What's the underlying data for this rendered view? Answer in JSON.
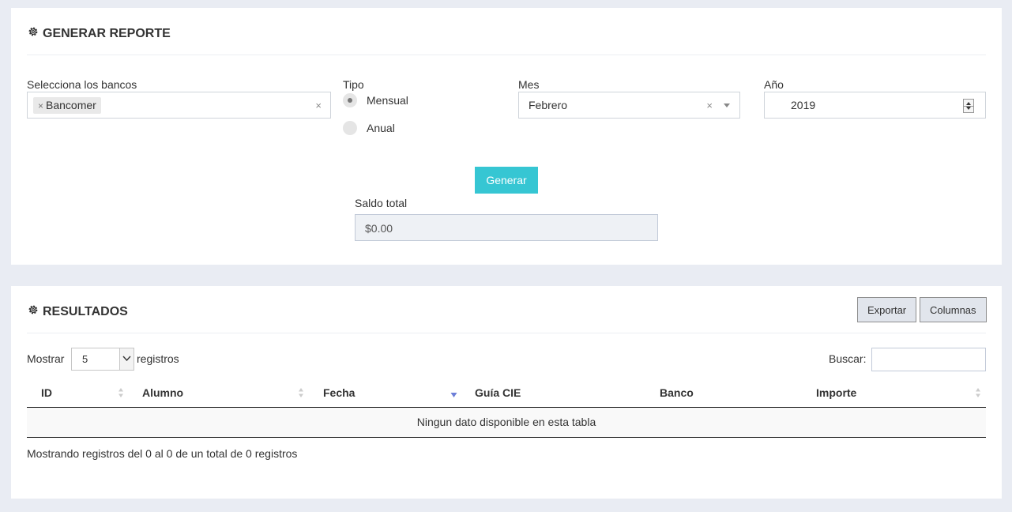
{
  "report": {
    "title": "GENERAR REPORTE",
    "banks": {
      "label": "Selecciona los bancos",
      "selected_tag": "Bancomer",
      "tag_remove": "×",
      "clear": "×"
    },
    "tipo": {
      "label": "Tipo",
      "options": [
        {
          "label": "Mensual",
          "checked": true
        },
        {
          "label": "Anual",
          "checked": false
        }
      ]
    },
    "mes": {
      "label": "Mes",
      "value": "Febrero",
      "clear": "×"
    },
    "anio": {
      "label": "Año",
      "value": "2019"
    },
    "generate_label": "Generar",
    "saldo": {
      "label": "Saldo total",
      "value": "$0.00"
    }
  },
  "results": {
    "title": "RESULTADOS",
    "export_label": "Exportar",
    "columns_label": "Columnas",
    "show_label": "Mostrar",
    "page_length": "5",
    "records_label": "registros",
    "search_label": "Buscar:",
    "columns": [
      "ID",
      "Alumno",
      "Fecha",
      "Guía CIE",
      "Banco",
      "Importe"
    ],
    "empty_message": "Ningun dato disponible en esta tabla",
    "info": "Mostrando registros del 0 al 0 de un total de 0 registros"
  },
  "colors": {
    "accent": "#36c6d3",
    "sort_active": "#6d7fd8",
    "page_bg": "#e9ecf3"
  }
}
